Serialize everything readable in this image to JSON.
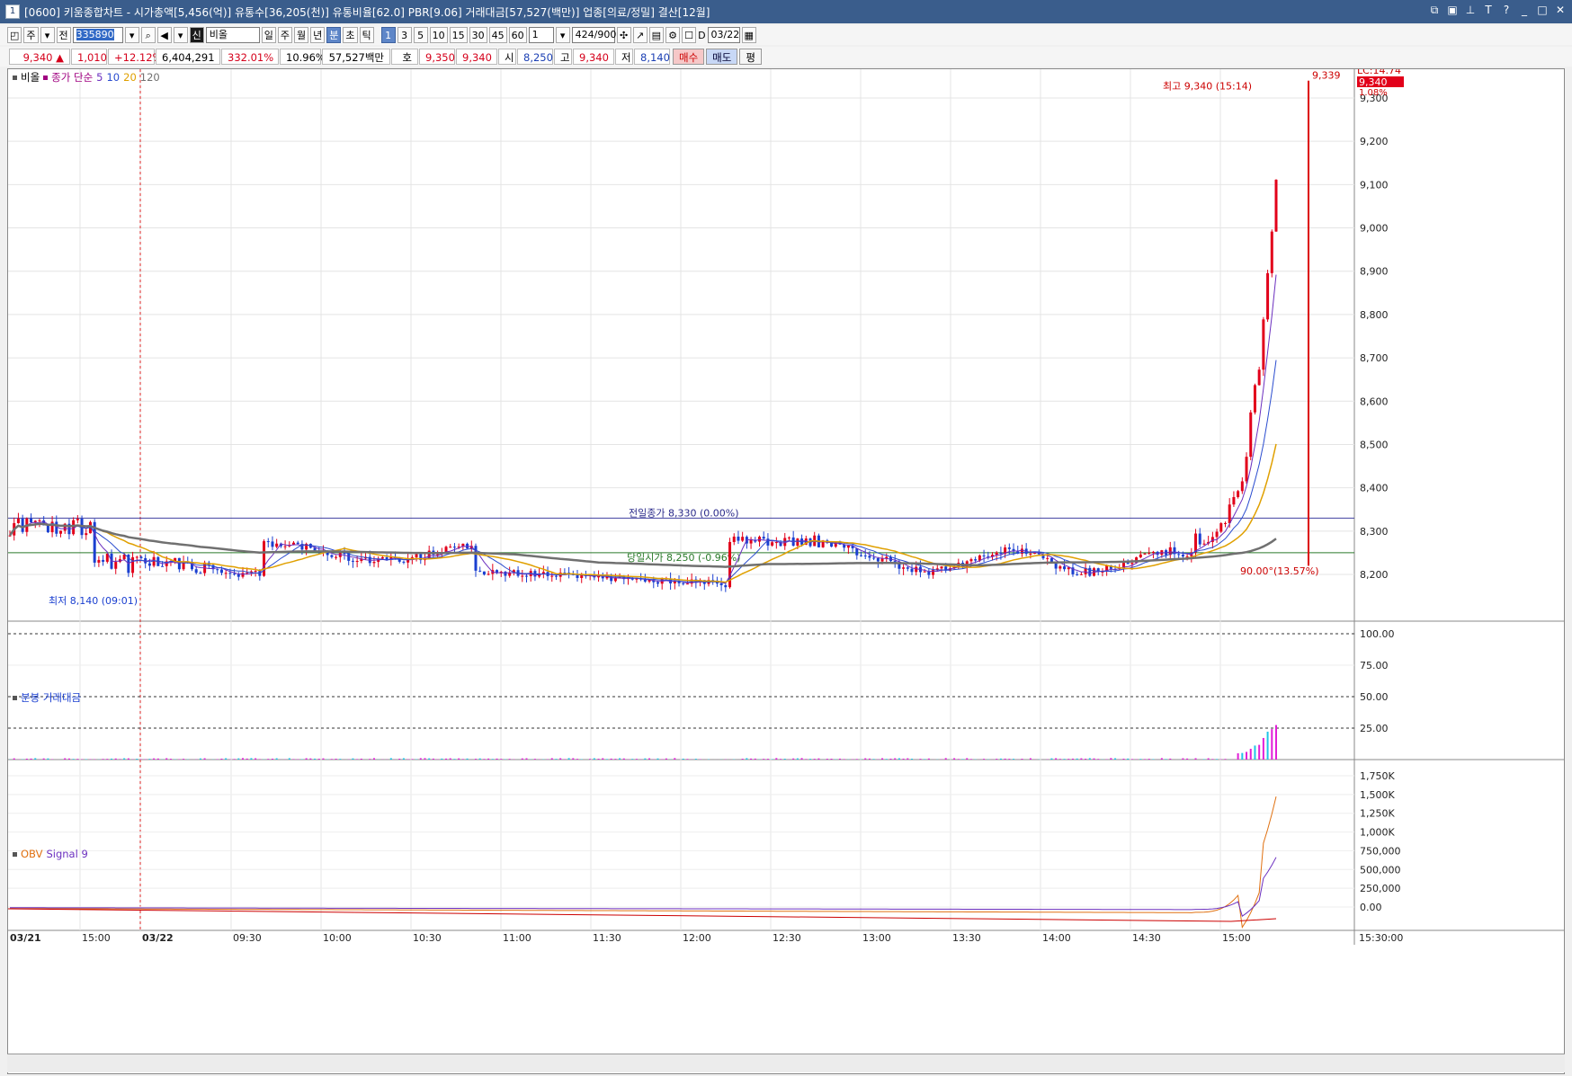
{
  "window": {
    "number": "1",
    "title": "[0600] 키움종합차트 - 시가총액[5,456(억)] 유통수[36,205(천)] 유통비율[62.0] PBR[9.06] 거래대금[57,527(백만)] 업종[의료/정밀] 결산[12월]"
  },
  "toolbar": {
    "type": "주",
    "scope": "전",
    "code": "335890",
    "search_mode": "신",
    "name": "비올",
    "periods": [
      "일",
      "주",
      "월",
      "년",
      "분",
      "초",
      "틱"
    ],
    "selected_period": "분",
    "intervals": [
      "1",
      "3",
      "5",
      "10",
      "15",
      "30",
      "45",
      "60"
    ],
    "selected_interval": "1",
    "multiplier": "1",
    "count": "424",
    "count_total": "/900",
    "d_label": "D",
    "date": "03/22"
  },
  "quote": {
    "price": "9,340 ▲",
    "change": "1,010",
    "change_pct": "+12.12%",
    "volume": "6,404,291",
    "vol_ratio": "332.01%",
    "turnover": "10.96%",
    "amount": "57,527백만",
    "bid_label": "호가",
    "ask": "9,350",
    "bid": "9,340",
    "open_label": "시",
    "open": "8,250",
    "high_label": "고",
    "high": "9,340",
    "low_label": "저",
    "low": "8,140",
    "buy": "매수",
    "sell": "매도",
    "flat": "평"
  },
  "price_panel": {
    "legend_name": "비올",
    "legend_ma": "종가 단순",
    "ma_periods": [
      "5",
      "10",
      "20",
      "120"
    ],
    "prev_close_label": "전일종가 8,330 (0.00%)",
    "open_label": "당일시가 8,250 (-0.96%)",
    "high_marker": "최고 9,340 (15:14)",
    "low_marker": "최저 8,140 (09:01)",
    "current_tag": "9,340",
    "lc_label": "LC:14.74",
    "pct_label": "1.08%",
    "right_price": "9,339",
    "range_label": "90.00°(13.57%)",
    "y_ticks": [
      "9,300",
      "9,200",
      "9,100",
      "9,000",
      "8,900",
      "8,800",
      "8,700",
      "8,600",
      "8,500",
      "8,400",
      "8,300",
      "8,200"
    ]
  },
  "volume_panel": {
    "legend": "분봉 거래대금",
    "y_ticks": [
      "100.00",
      "75.00",
      "50.00",
      "25.00"
    ]
  },
  "obv_panel": {
    "legend_obv": "OBV",
    "legend_signal": "Signal 9",
    "y_ticks": [
      "1,750K",
      "1,500K",
      "1,250K",
      "1,000K",
      "750,000",
      "500,000",
      "250,000",
      "0.00"
    ]
  },
  "x_axis": {
    "labels": [
      "03/21",
      "15:00",
      "03/22",
      "09:30",
      "10:00",
      "10:30",
      "11:00",
      "11:30",
      "12:00",
      "12:30",
      "13:00",
      "13:30",
      "14:00",
      "14:30",
      "15:00",
      "15:30:00"
    ]
  },
  "colors": {
    "up": "#e2001a",
    "down": "#1a3fd0",
    "ma5": "#6b2fbf",
    "ma10": "#2a4ccf",
    "ma20": "#e0a000",
    "ma120": "#707070",
    "prev_close_line": "#4040a0",
    "open_line": "#2a7a2a"
  }
}
